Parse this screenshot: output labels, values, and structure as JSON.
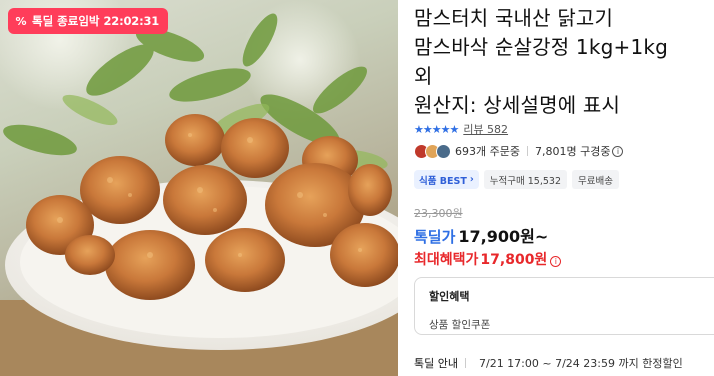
{
  "badge": {
    "label": "톡딜 종료임박",
    "timer": "22:02:31",
    "icon": "percent-icon"
  },
  "product": {
    "title_lines": [
      "맘스터치 국내산 닭고기",
      "맘스바삭 순살강정 1kg+1kg",
      "외",
      "원산지: 상세설명에 표시"
    ]
  },
  "rating": {
    "stars": "★★★★★",
    "stars_value": 5,
    "review_label": "리뷰 582"
  },
  "social": {
    "orders": "693개 주문중",
    "subscribers": "7,801명 구경중"
  },
  "tags": {
    "best": "식품 BEST",
    "cumulative": "누적구매 15,532",
    "shipping": "무료배송"
  },
  "price": {
    "original": "23,300원",
    "deal_label": "톡딜가",
    "deal_value": "17,900원~",
    "max_label": "최대혜택가",
    "max_value": "17,800원"
  },
  "coupon": {
    "header": "할인혜택",
    "sub": "상품 할인쿠폰"
  },
  "notice": {
    "label": "톡딜 안내",
    "period": "7/21 17:00 ~ 7/24 23:59 까지 한정할인"
  },
  "colors": {
    "badge_bg": "#ff3d5a",
    "accent_blue": "#2f6fe4",
    "accent_red": "#e8282b"
  }
}
